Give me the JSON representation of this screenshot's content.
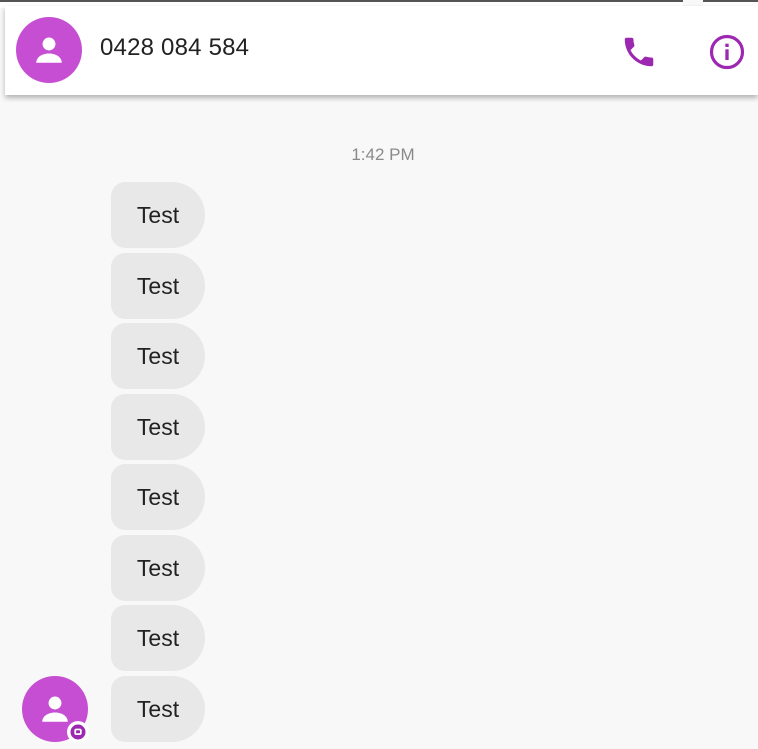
{
  "header": {
    "contact_name": "0428 084 584",
    "icons": {
      "avatar": "person-icon",
      "call": "phone-icon",
      "info": "info-icon"
    }
  },
  "conversation": {
    "timestamp": "1:42 PM",
    "messages": [
      {
        "text": "Test"
      },
      {
        "text": "Test"
      },
      {
        "text": "Test"
      },
      {
        "text": "Test"
      },
      {
        "text": "Test"
      },
      {
        "text": "Test"
      },
      {
        "text": "Test"
      },
      {
        "text": "Test"
      }
    ],
    "sender_avatar_icon": "person-icon",
    "badge_icon": "sms-badge-icon"
  },
  "colors": {
    "accent": "#9c27b0",
    "avatar": "#c64ed3",
    "bubble": "#e8e8e8",
    "background": "#f8f8f8"
  }
}
